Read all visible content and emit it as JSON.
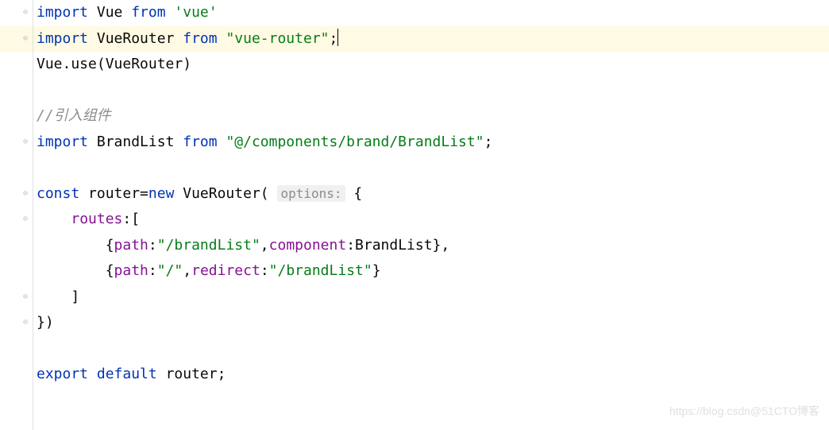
{
  "code": {
    "line1": {
      "kw1": "import",
      "id1": " Vue ",
      "kw2": "from",
      "str": " 'vue'"
    },
    "line2": {
      "kw1": "import",
      "id1": " VueRouter ",
      "kw2": "from",
      "str": " \"vue-router\"",
      "semi": ";"
    },
    "line3": {
      "txt": "Vue.use(VueRouter)"
    },
    "line5": {
      "comment": "//引入组件"
    },
    "line6": {
      "kw1": "import",
      "id1": " BrandList ",
      "kw2": "from",
      "str": " \"@/components/brand/BrandList\"",
      "semi": ";"
    },
    "line8": {
      "kw1": "const",
      "id1": " router=",
      "kw2": "new",
      "id2": " VueRouter( ",
      "hint": "options:",
      "brace": " {"
    },
    "line9": {
      "indent": "    ",
      "prop": "routes",
      "rest": ":["
    },
    "line10": {
      "indent": "        {",
      "prop1": "path",
      "c1": ":",
      "str1": "\"/brandList\"",
      "c2": ",",
      "prop2": "component",
      "c3": ":BrandList},"
    },
    "line11": {
      "indent": "        {",
      "prop1": "path",
      "c1": ":",
      "str1": "\"/\"",
      "c2": ",",
      "prop2": "redirect",
      "c3": ":",
      "str2": "\"/brandList\"",
      "c4": "}"
    },
    "line12": {
      "txt": "    ]"
    },
    "line13": {
      "txt": "})"
    },
    "line15": {
      "kw1": "export",
      "kw2": " default",
      "id": " router;"
    }
  },
  "watermark": "https://blog.csdn@51CTO博客"
}
